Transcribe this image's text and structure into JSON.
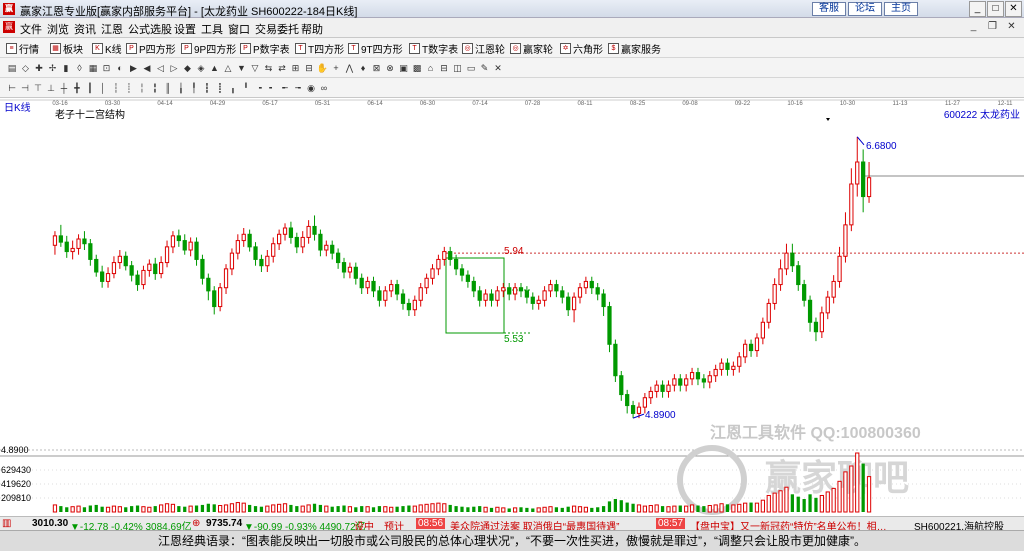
{
  "window": {
    "title": "赢家江恩专业版[赢家内部服务平台] - [太龙药业  SH600222-184日K线]",
    "links": [
      "客服",
      "论坛",
      "主页"
    ]
  },
  "menu": [
    "文件",
    "浏览",
    "资讯",
    "江恩",
    "公式选股",
    "设置",
    "工具",
    "窗口",
    "交易委托",
    "帮助"
  ],
  "toolbar": [
    {
      "icon": "list-icon",
      "label": "行情"
    },
    {
      "icon": "grid-icon",
      "label": "板块"
    },
    {
      "icon": "candle-icon",
      "label": "K线"
    },
    {
      "icon": "p-icon",
      "label": "P四方形"
    },
    {
      "icon": "p9-icon",
      "label": "9P四方形"
    },
    {
      "icon": "p-table-icon",
      "label": "P数字表"
    },
    {
      "icon": "t-icon",
      "label": "T四方形"
    },
    {
      "icon": "t9-icon",
      "label": "9T四方形"
    },
    {
      "icon": "t-table-icon",
      "label": "T数字表"
    },
    {
      "icon": "wheel-icon",
      "label": "江恩轮"
    },
    {
      "icon": "wheel2-icon",
      "label": "赢家轮"
    },
    {
      "icon": "hexagon-icon",
      "label": "六角形"
    },
    {
      "icon": "dollar-icon",
      "label": "赢家服务"
    }
  ],
  "chart": {
    "mode_label": "日K线",
    "indicator_label": "老子十二宫结构",
    "stock_label": "600222  太龙药业",
    "date_axis": [
      "03-16",
      "03-30",
      "04-14",
      "04-29",
      "05-17",
      "05-31",
      "06-14",
      "06-30",
      "07-14",
      "07-28",
      "08-11",
      "08-25",
      "09-08",
      "09-22",
      "10-16",
      "10-30",
      "11-13",
      "11-27",
      "12-11"
    ],
    "price_axis": [
      "4.8900"
    ],
    "volume_axis": [
      "629430",
      "419620",
      "209810"
    ],
    "annotations": {
      "high": "6.6800",
      "low": "4.8900",
      "upper": "5.94",
      "lower": "5.53"
    },
    "watermark_line1": "江恩工具软件  QQ:100800360",
    "watermark_logo_text": "赢家聊吧"
  },
  "chart_data": {
    "type": "candlestick",
    "title": "",
    "xlabel": "",
    "ylabel": "",
    "ylim": [
      4.7,
      6.8
    ],
    "annotations": {
      "high": 6.68,
      "low": 4.89,
      "box_upper": 5.94,
      "box_lower": 5.53
    },
    "candles": [
      [
        5.99,
        6.05,
        5.93,
        6.08
      ],
      [
        6.05,
        6.01,
        5.98,
        6.12
      ],
      [
        6.01,
        5.95,
        5.91,
        6.05
      ],
      [
        5.95,
        5.97,
        5.9,
        6.02
      ],
      [
        5.97,
        6.03,
        5.93,
        6.06
      ],
      [
        6.03,
        6.0,
        5.96,
        6.08
      ],
      [
        6.0,
        5.9,
        5.86,
        6.03
      ],
      [
        5.9,
        5.82,
        5.79,
        5.93
      ],
      [
        5.82,
        5.76,
        5.72,
        5.86
      ],
      [
        5.76,
        5.81,
        5.72,
        5.85
      ],
      [
        5.81,
        5.88,
        5.78,
        5.92
      ],
      [
        5.88,
        5.92,
        5.84,
        5.96
      ],
      [
        5.92,
        5.86,
        5.83,
        5.95
      ],
      [
        5.86,
        5.8,
        5.76,
        5.89
      ],
      [
        5.8,
        5.74,
        5.7,
        5.83
      ],
      [
        5.74,
        5.83,
        5.71,
        5.86
      ],
      [
        5.83,
        5.87,
        5.79,
        5.9
      ],
      [
        5.87,
        5.81,
        5.77,
        5.91
      ],
      [
        5.81,
        5.88,
        5.78,
        5.92
      ],
      [
        5.88,
        5.98,
        5.85,
        6.02
      ],
      [
        5.98,
        6.05,
        5.94,
        6.08
      ],
      [
        6.05,
        6.02,
        5.98,
        6.09
      ],
      [
        6.02,
        5.96,
        5.93,
        6.06
      ],
      [
        5.96,
        6.01,
        5.92,
        6.04
      ],
      [
        6.01,
        5.9,
        5.86,
        6.04
      ],
      [
        5.9,
        5.78,
        5.74,
        5.93
      ],
      [
        5.78,
        5.7,
        5.64,
        5.81
      ],
      [
        5.7,
        5.6,
        5.55,
        5.73
      ],
      [
        5.6,
        5.72,
        5.57,
        5.75
      ],
      [
        5.72,
        5.84,
        5.68,
        5.87
      ],
      [
        5.84,
        5.94,
        5.8,
        5.97
      ],
      [
        5.94,
        6.02,
        5.9,
        6.06
      ],
      [
        6.02,
        6.06,
        5.98,
        6.1
      ],
      [
        6.06,
        5.98,
        5.95,
        6.09
      ],
      [
        5.98,
        5.9,
        5.86,
        6.01
      ],
      [
        5.9,
        5.86,
        5.82,
        5.93
      ],
      [
        5.86,
        5.92,
        5.82,
        5.96
      ],
      [
        5.92,
        6.0,
        5.88,
        6.04
      ],
      [
        6.0,
        6.06,
        5.96,
        6.09
      ],
      [
        6.06,
        6.1,
        6.02,
        6.13
      ],
      [
        6.1,
        6.04,
        6.0,
        6.14
      ],
      [
        6.04,
        5.98,
        5.94,
        6.07
      ],
      [
        5.98,
        6.04,
        5.94,
        6.08
      ],
      [
        6.04,
        6.11,
        6.0,
        6.15
      ],
      [
        6.11,
        6.06,
        6.02,
        6.18
      ],
      [
        6.06,
        5.96,
        5.92,
        6.09
      ],
      [
        5.96,
        5.99,
        5.92,
        6.02
      ],
      [
        5.99,
        5.94,
        5.9,
        6.02
      ],
      [
        5.94,
        5.88,
        5.84,
        5.97
      ],
      [
        5.88,
        5.82,
        5.78,
        5.91
      ],
      [
        5.82,
        5.85,
        5.78,
        5.88
      ],
      [
        5.85,
        5.78,
        5.74,
        5.88
      ],
      [
        5.78,
        5.72,
        5.68,
        5.81
      ],
      [
        5.72,
        5.76,
        5.68,
        5.79
      ],
      [
        5.76,
        5.7,
        5.66,
        5.79
      ],
      [
        5.7,
        5.64,
        5.6,
        5.73
      ],
      [
        5.64,
        5.7,
        5.6,
        5.73
      ],
      [
        5.7,
        5.74,
        5.66,
        5.77
      ],
      [
        5.74,
        5.68,
        5.64,
        5.77
      ],
      [
        5.68,
        5.62,
        5.58,
        5.71
      ],
      [
        5.62,
        5.58,
        5.54,
        5.65
      ],
      [
        5.58,
        5.64,
        5.54,
        5.67
      ],
      [
        5.64,
        5.72,
        5.6,
        5.75
      ],
      [
        5.72,
        5.78,
        5.68,
        5.81
      ],
      [
        5.78,
        5.84,
        5.74,
        5.87
      ],
      [
        5.84,
        5.9,
        5.8,
        5.93
      ],
      [
        5.9,
        5.95,
        5.86,
        5.98
      ],
      [
        5.95,
        5.9,
        5.86,
        5.98
      ],
      [
        5.9,
        5.84,
        5.8,
        5.93
      ],
      [
        5.84,
        5.8,
        5.76,
        5.87
      ],
      [
        5.8,
        5.76,
        5.72,
        5.83
      ],
      [
        5.76,
        5.7,
        5.66,
        5.79
      ],
      [
        5.7,
        5.64,
        5.6,
        5.73
      ],
      [
        5.64,
        5.68,
        5.6,
        5.71
      ],
      [
        5.68,
        5.64,
        5.6,
        5.71
      ],
      [
        5.64,
        5.7,
        5.6,
        5.73
      ],
      [
        5.7,
        5.72,
        5.66,
        5.75
      ],
      [
        5.72,
        5.68,
        5.64,
        5.75
      ],
      [
        5.68,
        5.72,
        5.64,
        5.75
      ],
      [
        5.72,
        5.7,
        5.66,
        5.75
      ],
      [
        5.7,
        5.66,
        5.62,
        5.73
      ],
      [
        5.66,
        5.62,
        5.58,
        5.69
      ],
      [
        5.62,
        5.64,
        5.58,
        5.67
      ],
      [
        5.64,
        5.7,
        5.6,
        5.73
      ],
      [
        5.7,
        5.74,
        5.66,
        5.77
      ],
      [
        5.74,
        5.7,
        5.66,
        5.77
      ],
      [
        5.7,
        5.66,
        5.62,
        5.73
      ],
      [
        5.66,
        5.58,
        5.54,
        5.69
      ],
      [
        5.58,
        5.66,
        5.5,
        5.69
      ],
      [
        5.66,
        5.72,
        5.62,
        5.75
      ],
      [
        5.72,
        5.76,
        5.68,
        5.79
      ],
      [
        5.76,
        5.72,
        5.68,
        5.79
      ],
      [
        5.72,
        5.68,
        5.64,
        5.75
      ],
      [
        5.68,
        5.6,
        5.54,
        5.71
      ],
      [
        5.6,
        5.36,
        5.31,
        5.63
      ],
      [
        5.36,
        5.16,
        5.12,
        5.39
      ],
      [
        5.16,
        5.04,
        5.0,
        5.19
      ],
      [
        5.04,
        4.97,
        4.92,
        5.07
      ],
      [
        4.97,
        4.92,
        4.89,
        5.0
      ],
      [
        4.92,
        4.96,
        4.89,
        4.99
      ],
      [
        4.96,
        5.02,
        4.92,
        5.05
      ],
      [
        5.02,
        5.06,
        4.98,
        5.09
      ],
      [
        5.06,
        5.1,
        5.02,
        5.13
      ],
      [
        5.1,
        5.06,
        5.02,
        5.13
      ],
      [
        5.06,
        5.1,
        5.02,
        5.13
      ],
      [
        5.1,
        5.14,
        5.06,
        5.17
      ],
      [
        5.14,
        5.1,
        5.06,
        5.17
      ],
      [
        5.1,
        5.14,
        5.06,
        5.17
      ],
      [
        5.14,
        5.18,
        5.1,
        5.21
      ],
      [
        5.18,
        5.14,
        5.1,
        5.21
      ],
      [
        5.14,
        5.12,
        5.08,
        5.17
      ],
      [
        5.12,
        5.16,
        5.08,
        5.19
      ],
      [
        5.16,
        5.2,
        5.12,
        5.23
      ],
      [
        5.2,
        5.24,
        5.16,
        5.27
      ],
      [
        5.24,
        5.2,
        5.16,
        5.27
      ],
      [
        5.2,
        5.22,
        5.16,
        5.25
      ],
      [
        5.22,
        5.28,
        5.18,
        5.31
      ],
      [
        5.28,
        5.36,
        5.24,
        5.39
      ],
      [
        5.36,
        5.32,
        5.28,
        5.39
      ],
      [
        5.32,
        5.4,
        5.28,
        5.43
      ],
      [
        5.4,
        5.5,
        5.36,
        5.53
      ],
      [
        5.5,
        5.62,
        5.46,
        5.65
      ],
      [
        5.62,
        5.74,
        5.58,
        5.78
      ],
      [
        5.74,
        5.84,
        5.7,
        5.9
      ],
      [
        5.84,
        5.94,
        5.8,
        6.0
      ],
      [
        5.94,
        5.86,
        5.82,
        6.0
      ],
      [
        5.86,
        5.74,
        5.7,
        5.89
      ],
      [
        5.74,
        5.64,
        5.6,
        5.77
      ],
      [
        5.64,
        5.5,
        5.44,
        5.67
      ],
      [
        5.5,
        5.44,
        5.38,
        5.53
      ],
      [
        5.44,
        5.56,
        5.4,
        5.6
      ],
      [
        5.56,
        5.66,
        5.52,
        5.7
      ],
      [
        5.66,
        5.76,
        5.62,
        5.8
      ],
      [
        5.76,
        5.92,
        5.72,
        5.98
      ],
      [
        5.92,
        6.12,
        5.88,
        6.2
      ],
      [
        6.12,
        6.38,
        6.08,
        6.48
      ],
      [
        6.38,
        6.52,
        6.3,
        6.68
      ],
      [
        6.52,
        6.3,
        6.2,
        6.6
      ],
      [
        6.3,
        6.42,
        6.26,
        6.52
      ]
    ],
    "volumes": [
      0.12,
      0.1,
      0.08,
      0.09,
      0.1,
      0.08,
      0.11,
      0.12,
      0.09,
      0.08,
      0.1,
      0.09,
      0.08,
      0.1,
      0.11,
      0.09,
      0.08,
      0.1,
      0.12,
      0.14,
      0.13,
      0.1,
      0.09,
      0.1,
      0.11,
      0.12,
      0.14,
      0.13,
      0.11,
      0.12,
      0.14,
      0.16,
      0.15,
      0.12,
      0.1,
      0.09,
      0.1,
      0.12,
      0.13,
      0.14,
      0.12,
      0.1,
      0.1,
      0.12,
      0.14,
      0.12,
      0.1,
      0.09,
      0.1,
      0.11,
      0.09,
      0.08,
      0.1,
      0.09,
      0.08,
      0.1,
      0.09,
      0.08,
      0.09,
      0.1,
      0.11,
      0.1,
      0.12,
      0.13,
      0.14,
      0.15,
      0.14,
      0.12,
      0.1,
      0.09,
      0.08,
      0.09,
      0.1,
      0.08,
      0.07,
      0.08,
      0.07,
      0.06,
      0.07,
      0.08,
      0.07,
      0.06,
      0.07,
      0.08,
      0.09,
      0.08,
      0.07,
      0.09,
      0.1,
      0.09,
      0.08,
      0.07,
      0.08,
      0.1,
      0.18,
      0.22,
      0.2,
      0.16,
      0.14,
      0.12,
      0.1,
      0.11,
      0.12,
      0.1,
      0.09,
      0.1,
      0.11,
      0.1,
      0.12,
      0.11,
      0.1,
      0.11,
      0.12,
      0.14,
      0.13,
      0.12,
      0.13,
      0.15,
      0.16,
      0.15,
      0.2,
      0.28,
      0.32,
      0.36,
      0.42,
      0.3,
      0.26,
      0.22,
      0.3,
      0.24,
      0.28,
      0.34,
      0.4,
      0.52,
      0.68,
      0.78,
      1.0,
      0.82,
      0.6
    ],
    "volume_ylim": [
      0,
      839240
    ]
  },
  "status": {
    "index1": "3010.30",
    "index1_change": "▼-12.78 -0.42% 3084.69亿",
    "index2": "9735.74",
    "index2_change": "▼-90.99 -0.93% 4490.72亿",
    "ticker": "预计",
    "news_time1": "08:56",
    "news1": "美众院通过法案 取消俄白“最惠国待遇”",
    "news_time2": "08:57",
    "news2": "【盘中宝】又一新冠药“特仿”名单公布！相…",
    "mid_label": "设中",
    "right_stock": "SH600221,海航控股"
  },
  "quote_bar": "江恩经典语录：“图表能反映出一切股市或公司股民的总体心理状况”，“不要一次性买进，傲慢就是罪过”，“调整只会让股市更加健康”。",
  "colors": {
    "up": "#dd0000",
    "down": "#009900",
    "bg": "#ffffff",
    "line": "#cc3333"
  }
}
